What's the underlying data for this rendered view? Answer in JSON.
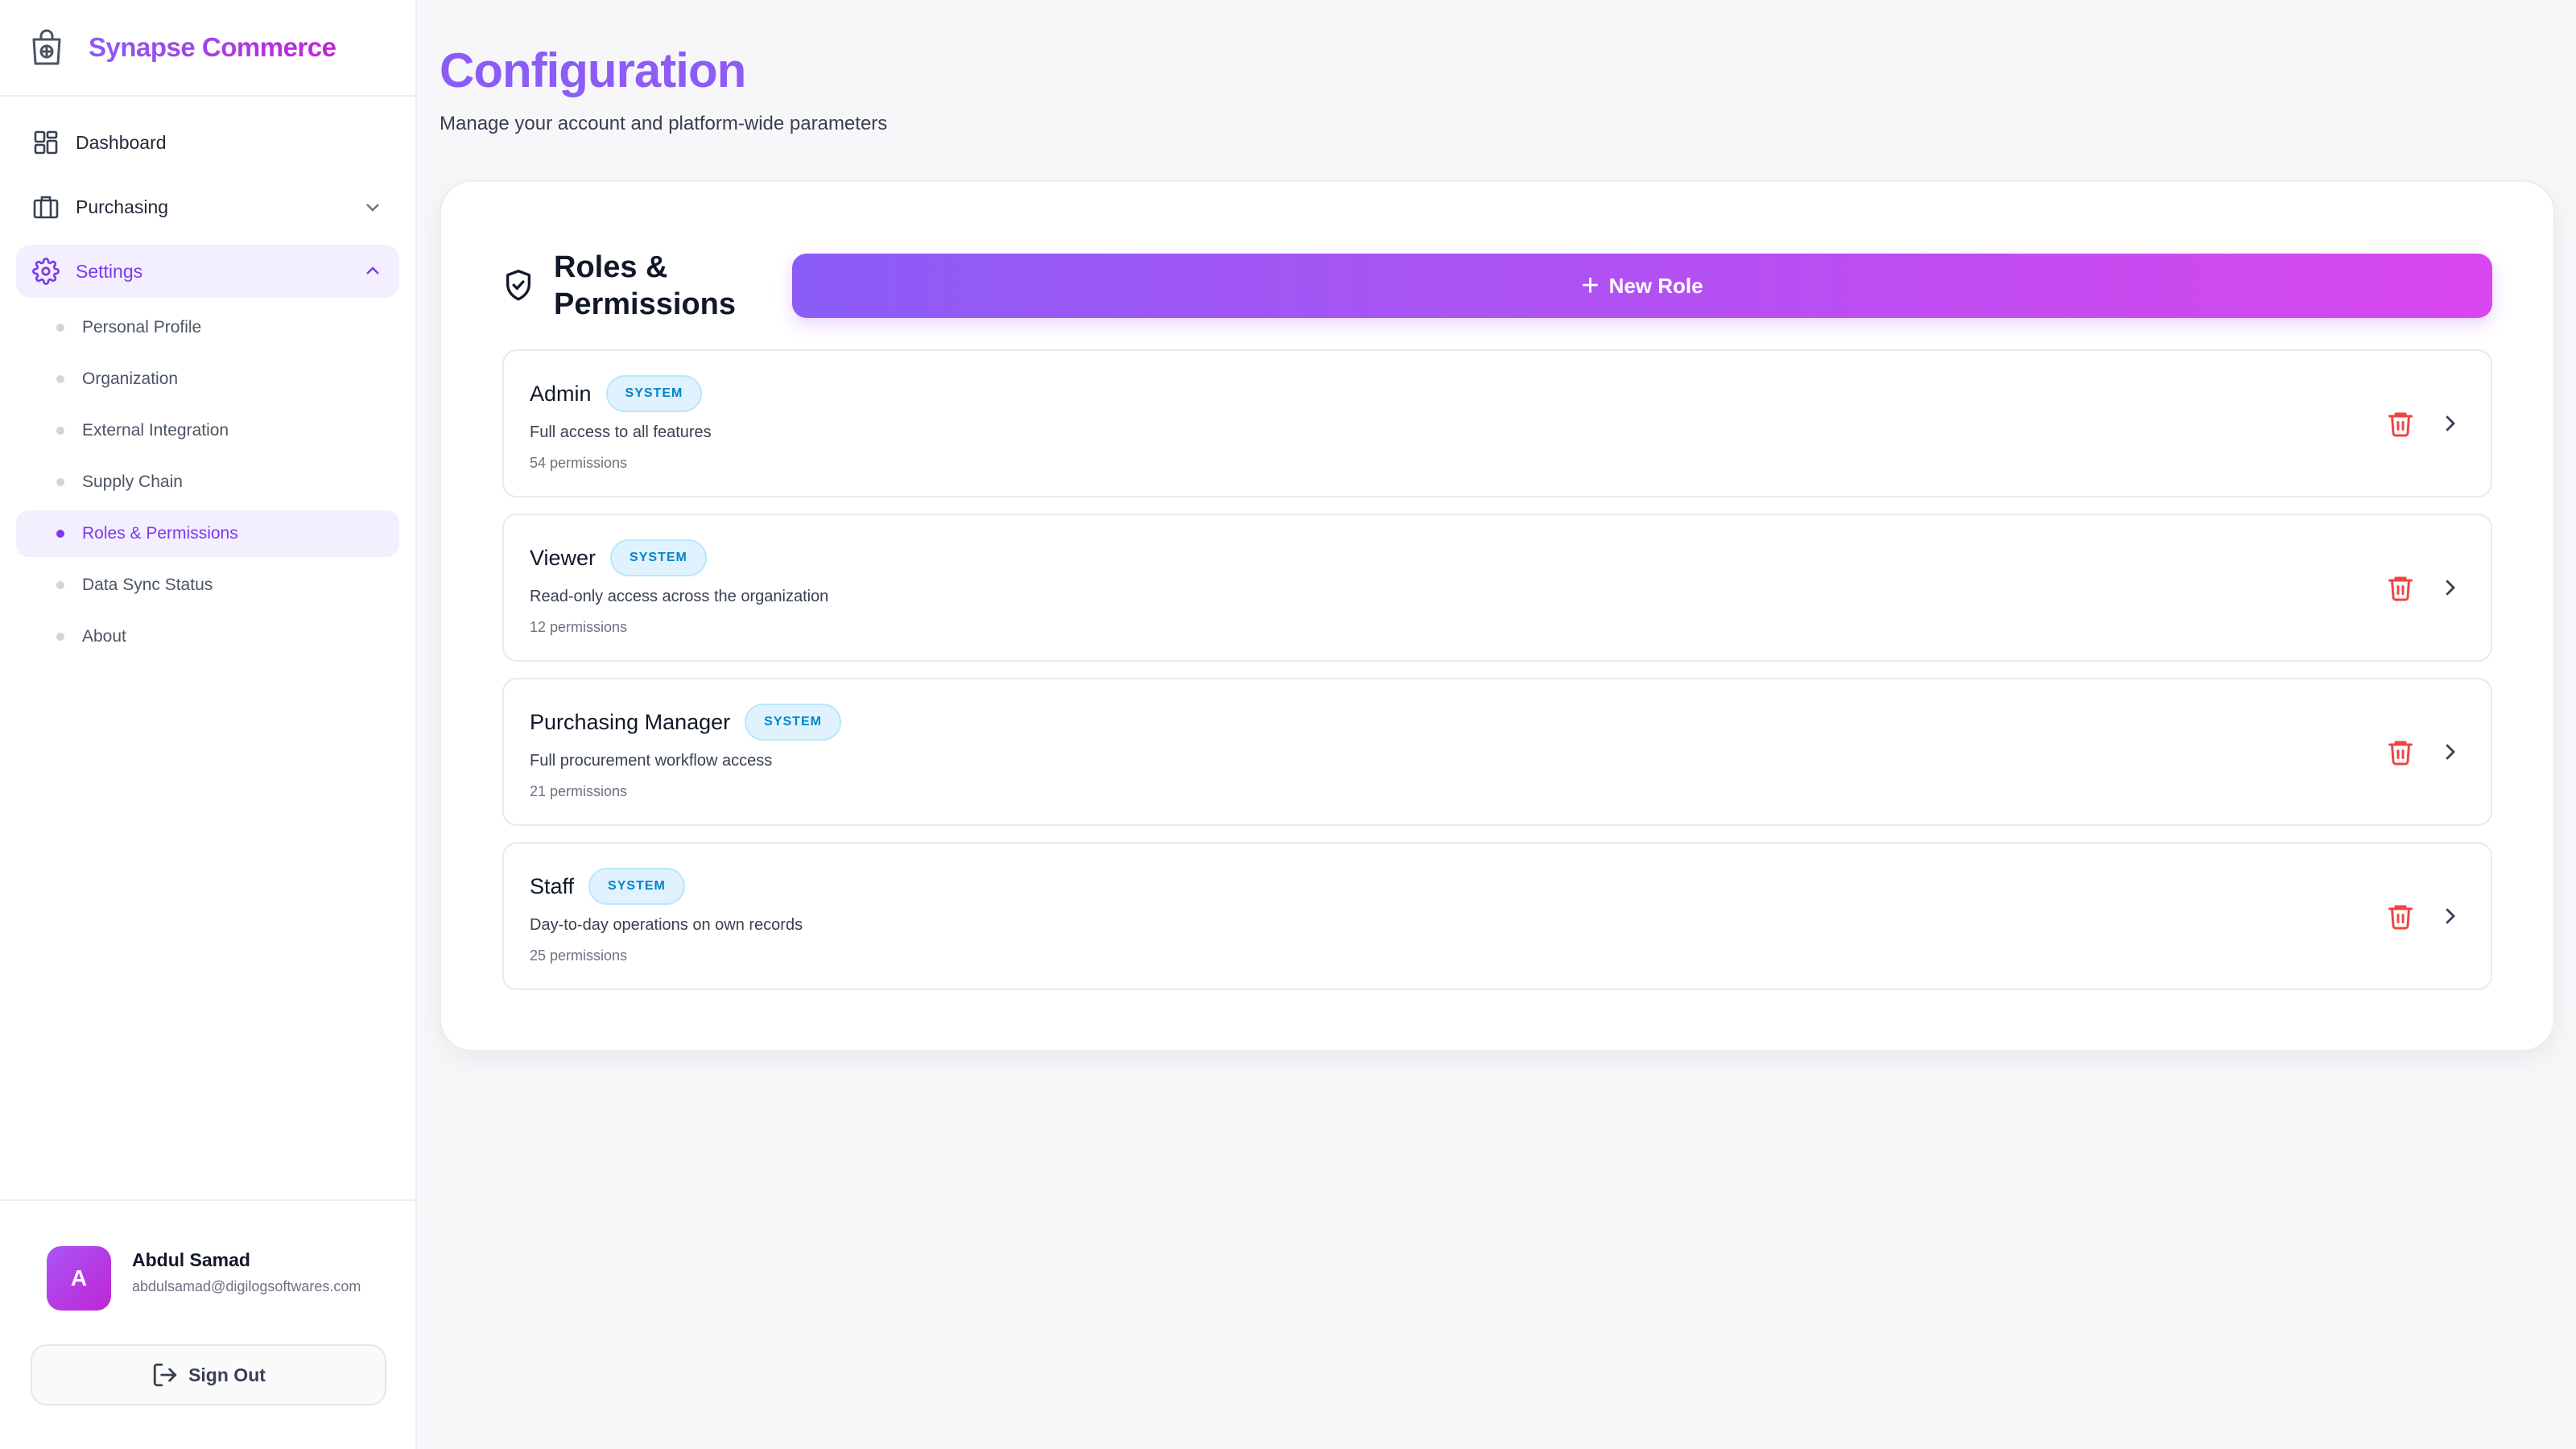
{
  "brand": {
    "name": "Synapse Commerce"
  },
  "nav": {
    "items": [
      {
        "label": "Dashboard"
      },
      {
        "label": "Purchasing"
      },
      {
        "label": "Settings"
      }
    ],
    "settings_sub": [
      {
        "label": "Personal Profile"
      },
      {
        "label": "Organization"
      },
      {
        "label": "External Integration"
      },
      {
        "label": "Supply Chain"
      },
      {
        "label": "Roles & Permissions"
      },
      {
        "label": "Data Sync Status"
      },
      {
        "label": "About"
      }
    ]
  },
  "user": {
    "initial": "A",
    "name": "Abdul Samad",
    "email": "abdulsamad@digilogsoftwares.com"
  },
  "signout_label": "Sign Out",
  "page": {
    "title": "Configuration",
    "subtitle": "Manage your account and platform-wide parameters"
  },
  "roles_card": {
    "title": "Roles & Permissions",
    "new_role_label": "New Role",
    "roles": [
      {
        "name": "Admin",
        "badge": "SYSTEM",
        "description": "Full access to all features",
        "permissions": "54 permissions"
      },
      {
        "name": "Viewer",
        "badge": "SYSTEM",
        "description": "Read-only access across the organization",
        "permissions": "12 permissions"
      },
      {
        "name": "Purchasing Manager",
        "badge": "SYSTEM",
        "description": "Full procurement workflow access",
        "permissions": "21 permissions"
      },
      {
        "name": "Staff",
        "badge": "SYSTEM",
        "description": "Day-to-day operations on own records",
        "permissions": "25 permissions"
      }
    ]
  },
  "colors": {
    "accent": "#8b5cf6",
    "accent_pink": "#d946ef",
    "danger": "#ef4444",
    "badge_blue": "#0284c7"
  }
}
